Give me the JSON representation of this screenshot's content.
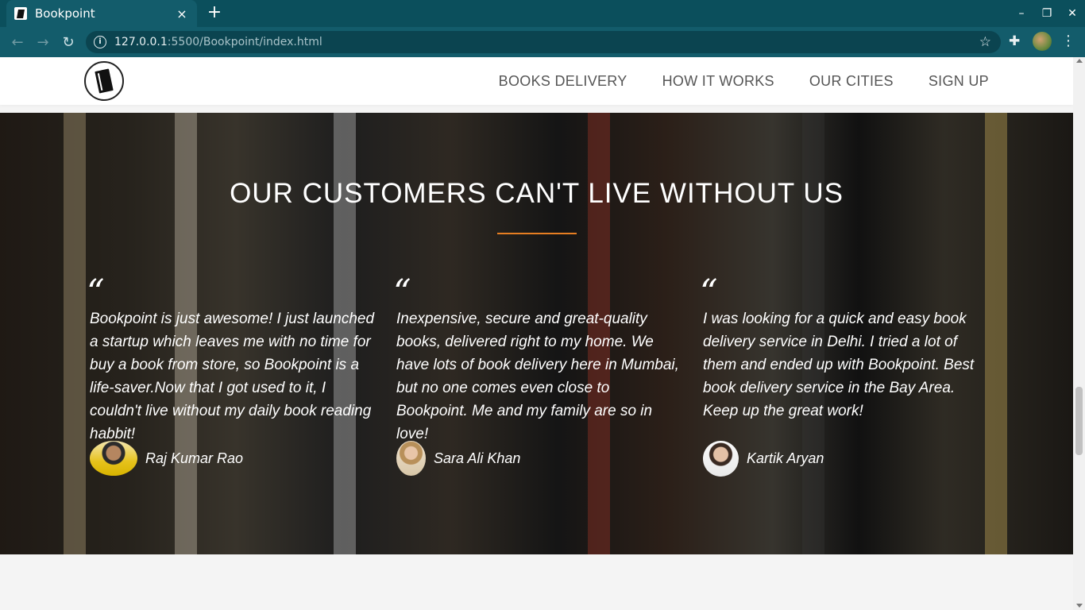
{
  "browser": {
    "tab_title": "Bookpoint",
    "tab_close": "×",
    "new_tab": "+",
    "url_host": "127.0.0.1",
    "url_rest": ":5500/Bookpoint/index.html",
    "window_controls": [
      "–",
      "❐",
      "✕"
    ]
  },
  "nav": {
    "links": [
      "BOOKS DELIVERY",
      "HOW IT WORKS",
      "OUR CITIES",
      "SIGN UP"
    ]
  },
  "testimonials": {
    "heading": "OUR CUSTOMERS CAN'T LIVE WITHOUT US",
    "quote_mark": "“",
    "items": [
      {
        "text": "Bookpoint is just awesome! I just launched a startup which leaves me with no time for buy a book from store, so Bookpoint is a life-saver.Now that I got used to it, I couldn't live without my daily book reading habbit!",
        "author": "Raj Kumar Rao"
      },
      {
        "text": "Inexpensive, secure and great-quality books, delivered right to my home. We have lots of book delivery here in Mumbai, but no one comes even close to Bookpoint. Me and my family are so in love!",
        "author": "Sara Ali Khan"
      },
      {
        "text": "I was looking for a quick and easy book delivery service in Delhi. I tried a lot of them and ended up with Bookpoint. Best book delivery service in the Bay Area. Keep up the great work!",
        "author": "Kartik Aryan"
      }
    ]
  },
  "colors": {
    "chrome": "#135c6b",
    "tabstrip": "#0b4f5c",
    "accent_rule": "#e67e22"
  }
}
